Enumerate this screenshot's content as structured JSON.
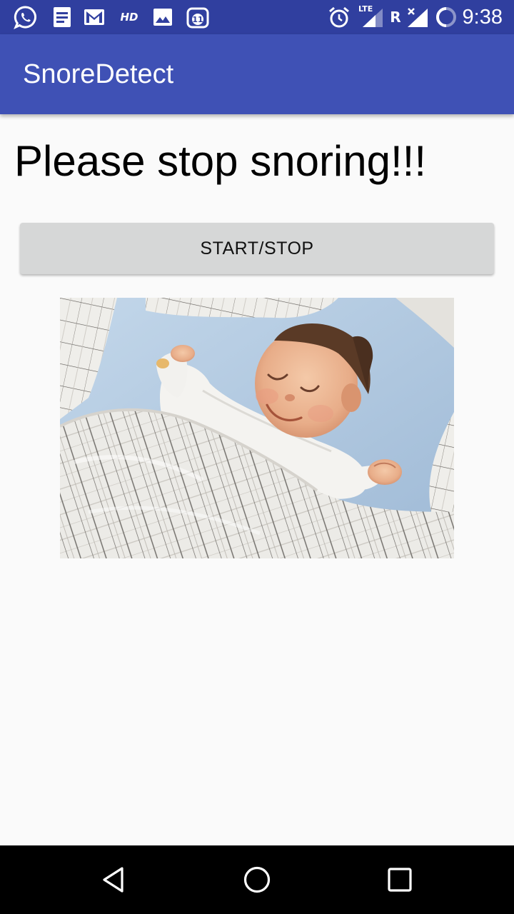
{
  "status_bar": {
    "time": "9:38",
    "notification_icons": [
      "whatsapp-icon",
      "document-icon",
      "gmail-icon",
      "hd-icon",
      "gallery-icon",
      "calendar-icon"
    ],
    "hd_label": "HD",
    "calendar_day": "11",
    "system_icons": [
      "alarm-icon",
      "lte-signal-icon",
      "roaming-icon",
      "no-signal-icon",
      "battery-charging-icon"
    ],
    "lte_label": "LTE",
    "roaming_label": "R"
  },
  "app_bar": {
    "title": "SnoreDetect",
    "color": "#3f51b5",
    "status_color": "#303f9f"
  },
  "main": {
    "message": "Please stop snoring!!!",
    "start_stop_label": "START/STOP",
    "image_icon": "sleeping-baby-image"
  },
  "nav_bar": {
    "buttons": [
      "back-icon",
      "home-icon",
      "recents-icon"
    ]
  }
}
